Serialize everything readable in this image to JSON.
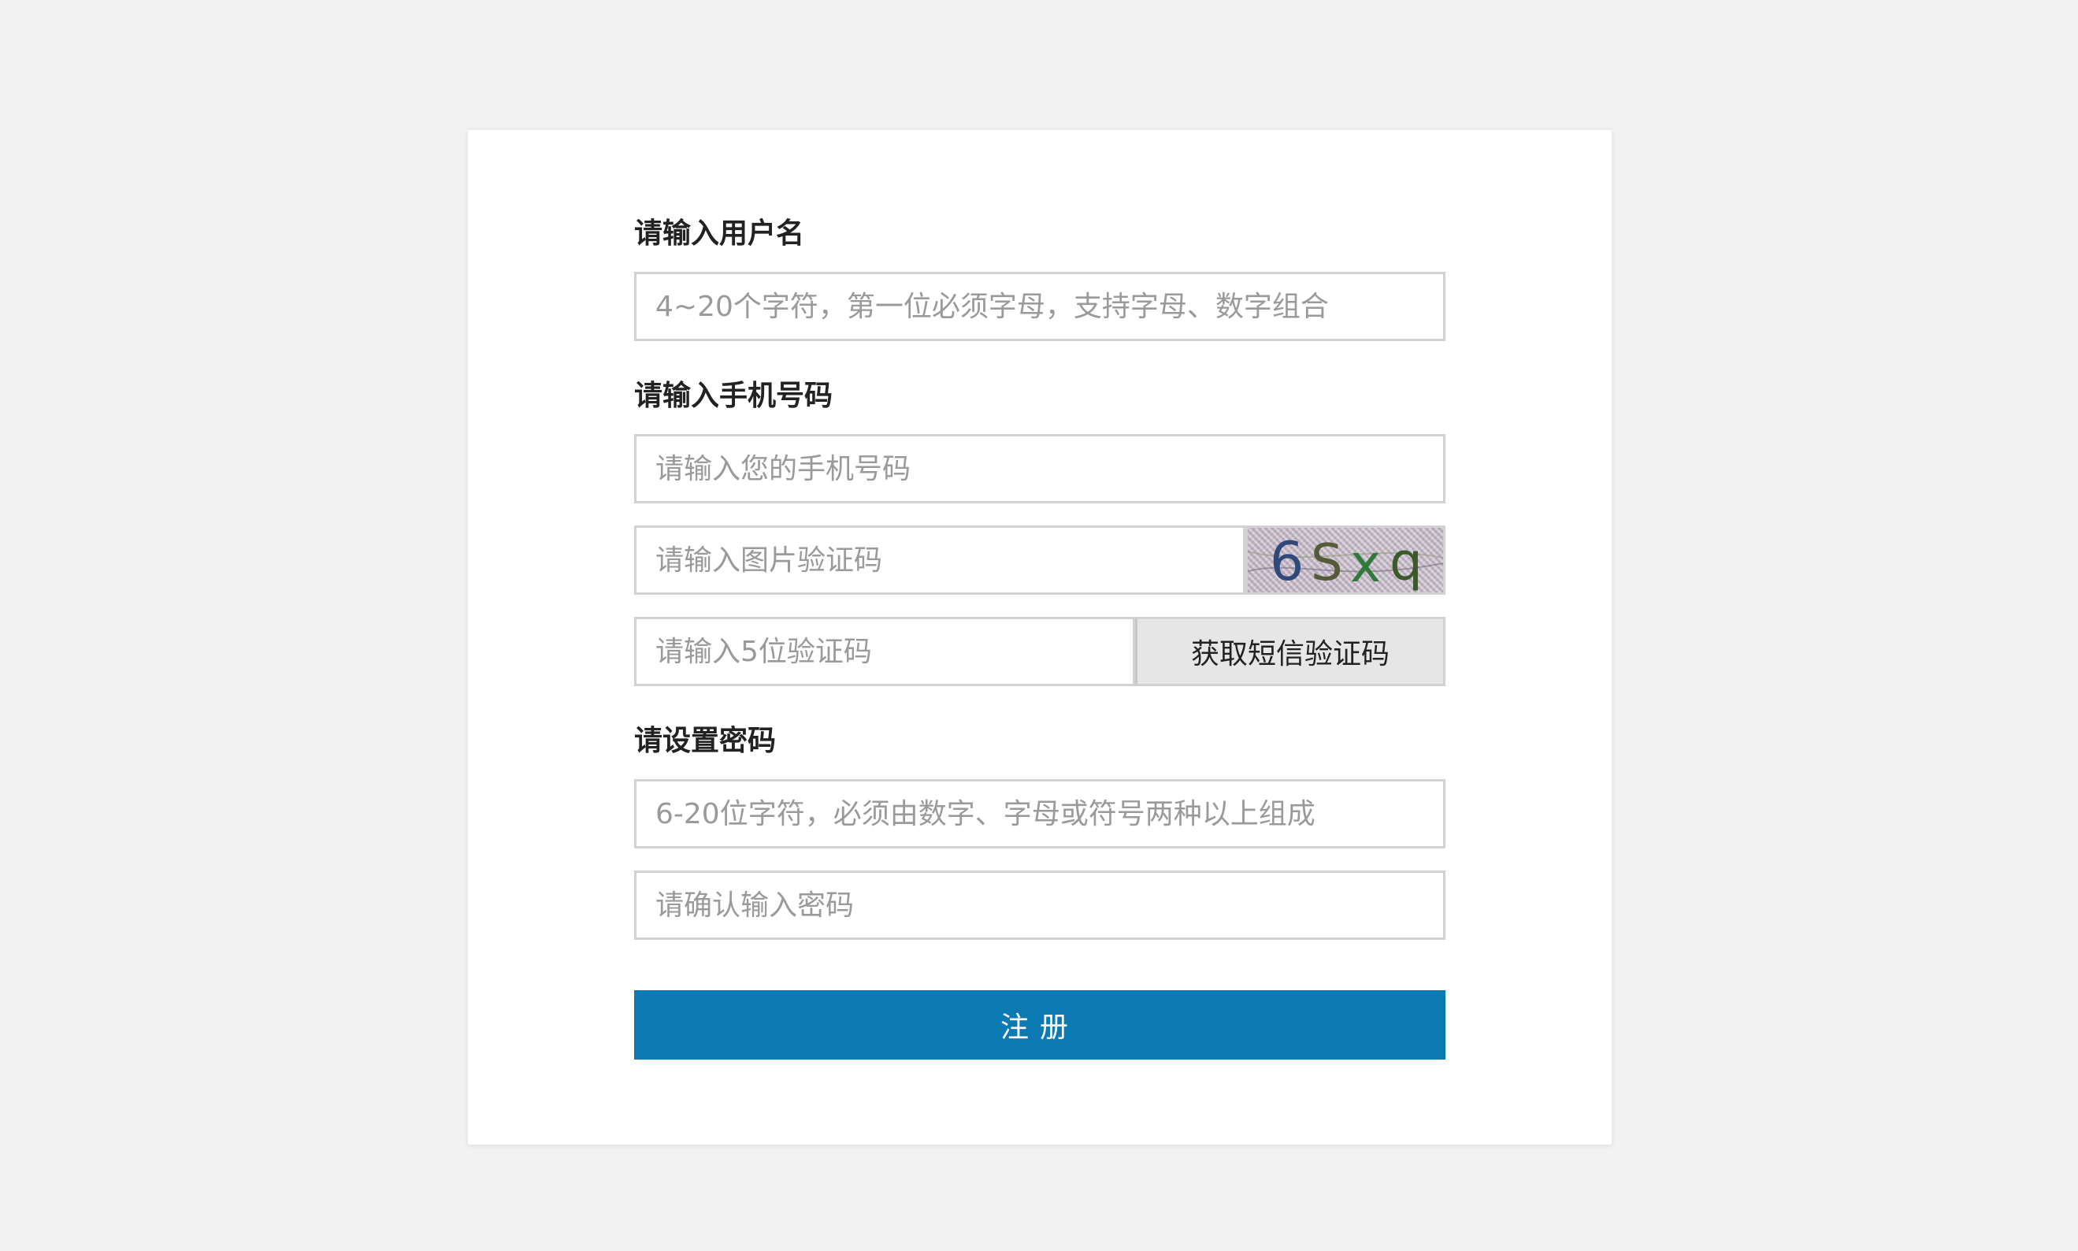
{
  "username": {
    "label": "请输入用户名",
    "placeholder": "4~20个字符，第一位必须字母，支持字母、数字组合"
  },
  "phone": {
    "label": "请输入手机号码",
    "placeholder": "请输入您的手机号码"
  },
  "captcha": {
    "placeholder": "请输入图片验证码",
    "image_text": "6Sxq"
  },
  "sms": {
    "placeholder": "请输入5位验证码",
    "button_label": "获取短信验证码"
  },
  "password": {
    "label": "请设置密码",
    "placeholder": "6-20位字符，必须由数字、字母或符号两种以上组成",
    "confirm_placeholder": "请确认输入密码"
  },
  "submit": {
    "label": "注册"
  },
  "colors": {
    "page_background": "#f2f2f2",
    "card_background": "#ffffff",
    "primary": "#0b7ab3",
    "input_border": "#d2d2d2",
    "secondary_button": "#e6e6e6"
  }
}
